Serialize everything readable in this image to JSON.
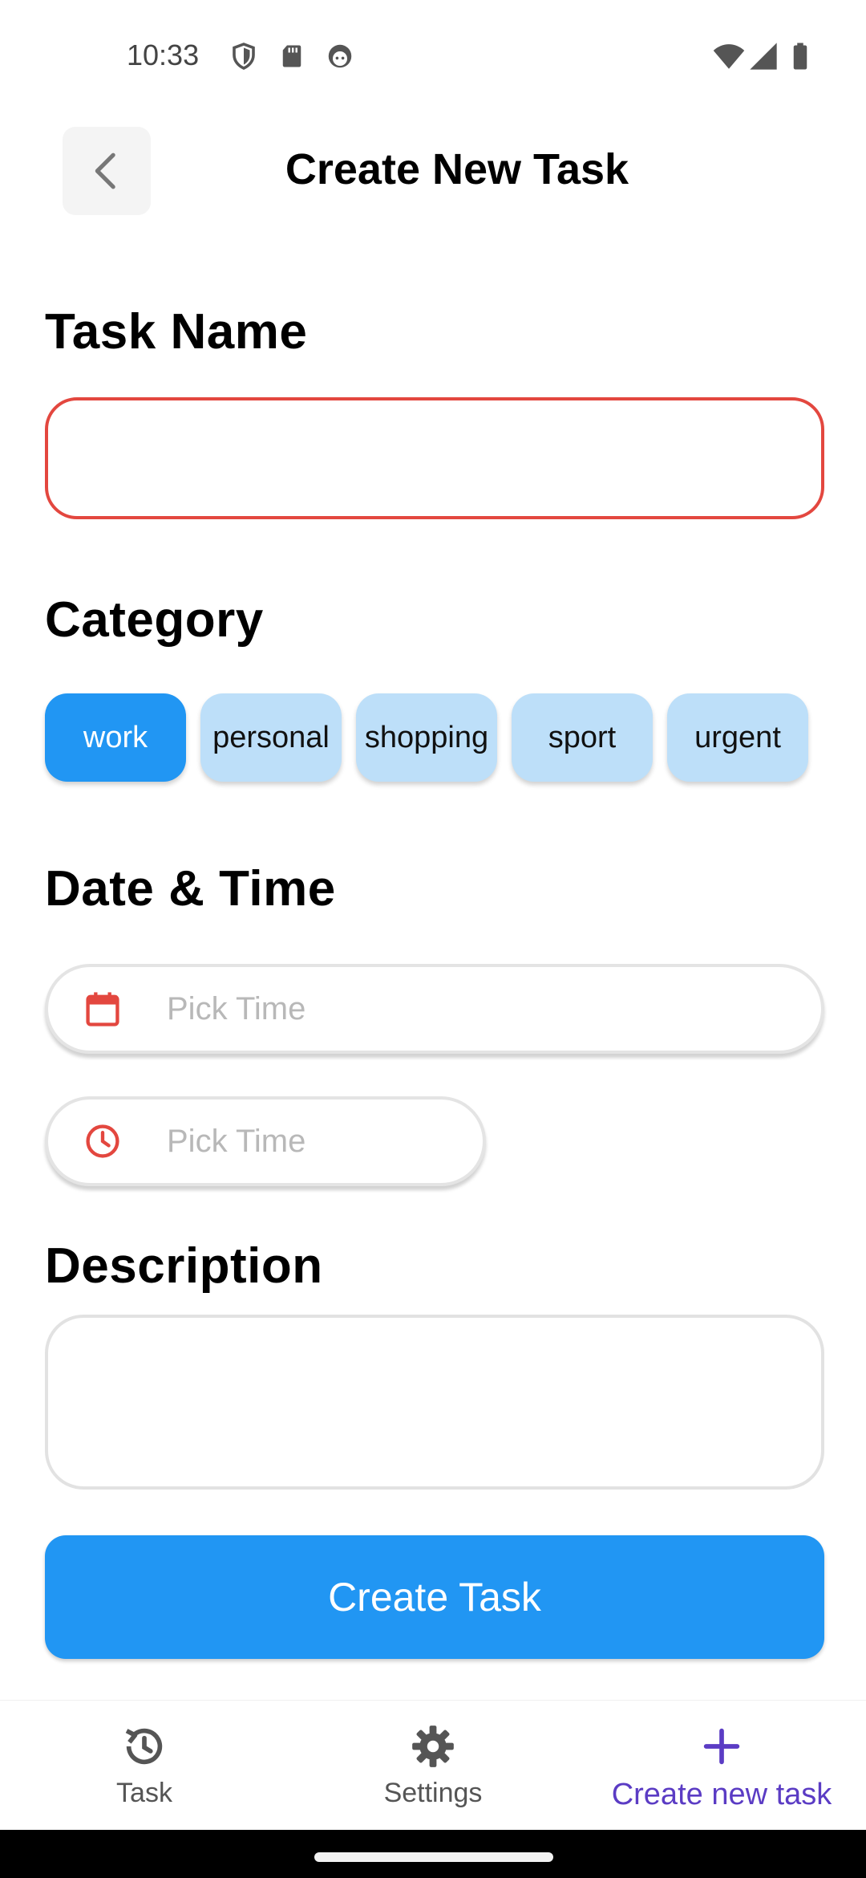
{
  "status_bar": {
    "time": "10:33",
    "icons": [
      "shield-icon",
      "sd-card-icon",
      "android-face-icon",
      "wifi-icon",
      "signal-icon",
      "battery-icon"
    ]
  },
  "header": {
    "title": "Create New Task",
    "back_icon": "chevron-left-icon"
  },
  "form": {
    "task_name": {
      "label": "Task Name",
      "value": "",
      "border_color": "#e3473f"
    },
    "category": {
      "label": "Category",
      "options": [
        "work",
        "personal",
        "shopping",
        "sport",
        "urgent"
      ],
      "selected": "work"
    },
    "date_time": {
      "label": "Date & Time",
      "date_placeholder": "Pick Time",
      "time_placeholder": "Pick Time"
    },
    "description": {
      "label": "Description",
      "value": ""
    },
    "submit_label": "Create Task"
  },
  "bottom_nav": {
    "items": [
      {
        "label": "Task",
        "icon": "history-icon"
      },
      {
        "label": "Settings",
        "icon": "gear-icon"
      },
      {
        "label": "Create new task",
        "icon": "plus-icon"
      }
    ],
    "active_index": 2
  },
  "colors": {
    "accent": "#2196f3",
    "chip_background": "#bddff9",
    "error": "#e3473f",
    "nav_active": "#5b3cc4"
  }
}
